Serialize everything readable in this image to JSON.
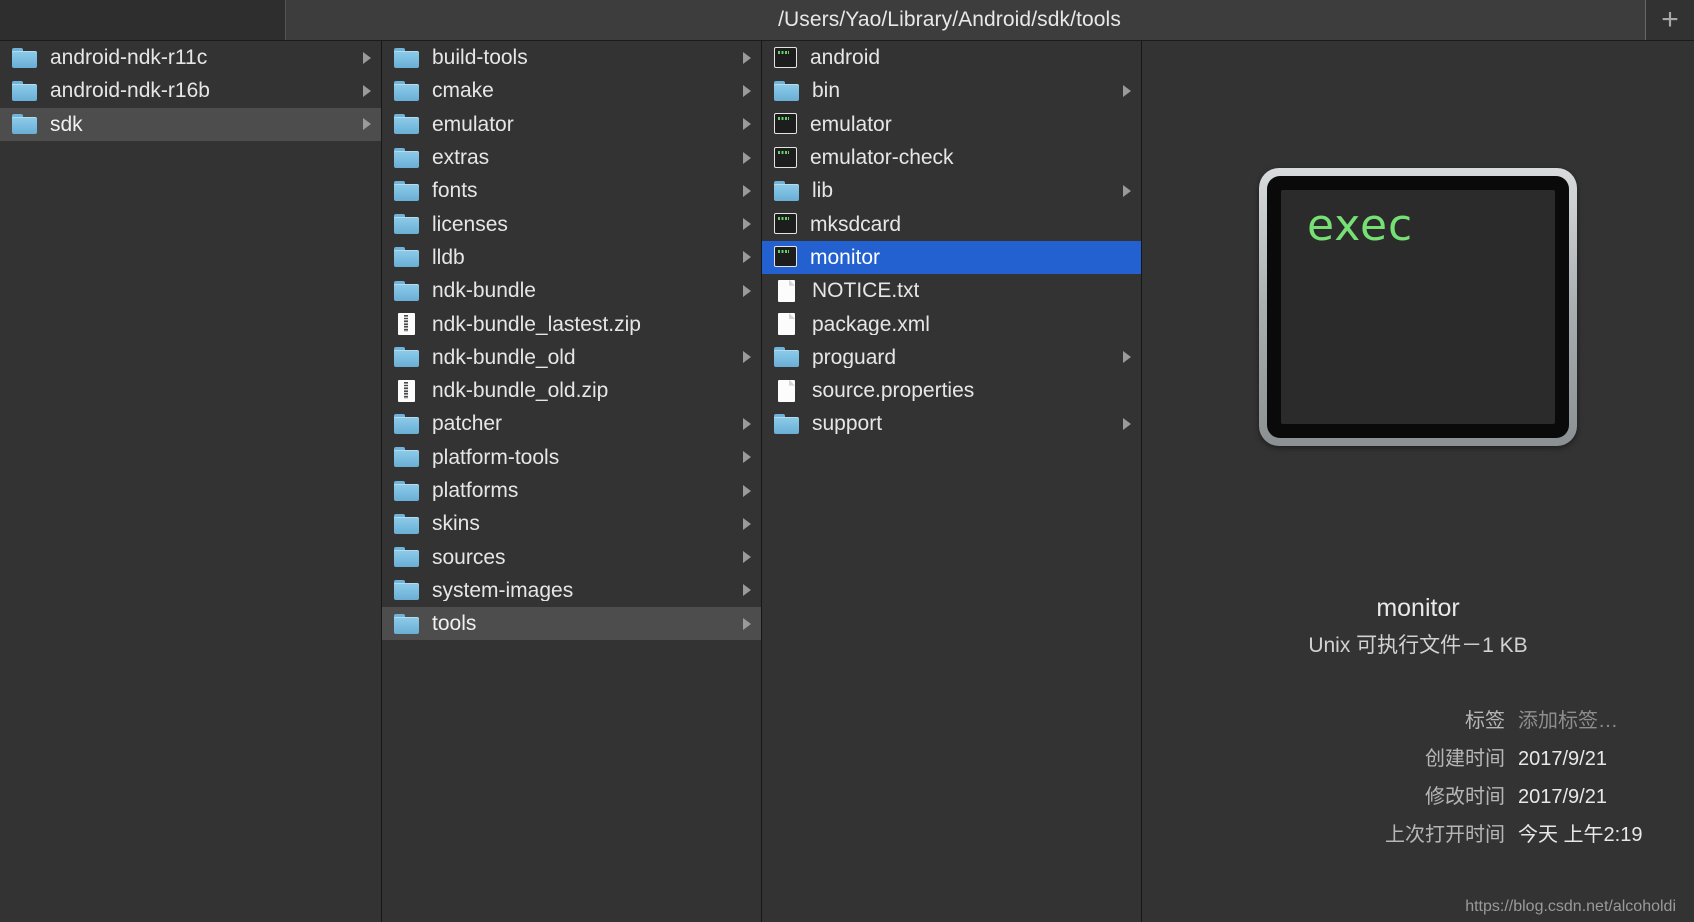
{
  "window": {
    "title": "/Users/Yao/Library/Android/sdk/tools",
    "add_button_label": "+"
  },
  "columns": [
    {
      "name": "column-1",
      "items": [
        {
          "label": "android-ndk-r11c",
          "icon": "folder-icon",
          "has_arrow": true,
          "state": "normal"
        },
        {
          "label": "android-ndk-r16b",
          "icon": "folder-icon",
          "has_arrow": true,
          "state": "normal"
        },
        {
          "label": "sdk",
          "icon": "folder-icon",
          "has_arrow": true,
          "state": "selected-inactive"
        }
      ]
    },
    {
      "name": "column-2",
      "items": [
        {
          "label": "build-tools",
          "icon": "folder-icon",
          "has_arrow": true,
          "state": "normal"
        },
        {
          "label": "cmake",
          "icon": "folder-icon",
          "has_arrow": true,
          "state": "normal"
        },
        {
          "label": "emulator",
          "icon": "folder-icon",
          "has_arrow": true,
          "state": "normal"
        },
        {
          "label": "extras",
          "icon": "folder-icon",
          "has_arrow": true,
          "state": "normal"
        },
        {
          "label": "fonts",
          "icon": "folder-icon",
          "has_arrow": true,
          "state": "normal"
        },
        {
          "label": "licenses",
          "icon": "folder-icon",
          "has_arrow": true,
          "state": "normal"
        },
        {
          "label": "lldb",
          "icon": "folder-icon",
          "has_arrow": true,
          "state": "normal"
        },
        {
          "label": "ndk-bundle",
          "icon": "folder-icon",
          "has_arrow": true,
          "state": "normal"
        },
        {
          "label": "ndk-bundle_lastest.zip",
          "icon": "zip-file-icon",
          "has_arrow": false,
          "state": "normal"
        },
        {
          "label": "ndk-bundle_old",
          "icon": "folder-icon",
          "has_arrow": true,
          "state": "normal"
        },
        {
          "label": "ndk-bundle_old.zip",
          "icon": "zip-file-icon",
          "has_arrow": false,
          "state": "normal"
        },
        {
          "label": "patcher",
          "icon": "folder-icon",
          "has_arrow": true,
          "state": "normal"
        },
        {
          "label": "platform-tools",
          "icon": "folder-icon",
          "has_arrow": true,
          "state": "normal"
        },
        {
          "label": "platforms",
          "icon": "folder-icon",
          "has_arrow": true,
          "state": "normal"
        },
        {
          "label": "skins",
          "icon": "folder-icon",
          "has_arrow": true,
          "state": "normal"
        },
        {
          "label": "sources",
          "icon": "folder-icon",
          "has_arrow": true,
          "state": "normal"
        },
        {
          "label": "system-images",
          "icon": "folder-icon",
          "has_arrow": true,
          "state": "normal"
        },
        {
          "label": "tools",
          "icon": "folder-icon",
          "has_arrow": true,
          "state": "selected-inactive"
        }
      ]
    },
    {
      "name": "column-3",
      "items": [
        {
          "label": "android",
          "icon": "unix-executable-icon",
          "has_arrow": false,
          "state": "normal"
        },
        {
          "label": "bin",
          "icon": "folder-icon",
          "has_arrow": true,
          "state": "normal"
        },
        {
          "label": "emulator",
          "icon": "unix-executable-icon",
          "has_arrow": false,
          "state": "normal"
        },
        {
          "label": "emulator-check",
          "icon": "unix-executable-icon",
          "has_arrow": false,
          "state": "normal"
        },
        {
          "label": "lib",
          "icon": "folder-icon",
          "has_arrow": true,
          "state": "normal"
        },
        {
          "label": "mksdcard",
          "icon": "unix-executable-icon",
          "has_arrow": false,
          "state": "normal"
        },
        {
          "label": "monitor",
          "icon": "unix-executable-icon",
          "has_arrow": false,
          "state": "selected-active"
        },
        {
          "label": "NOTICE.txt",
          "icon": "text-file-icon",
          "has_arrow": false,
          "state": "normal"
        },
        {
          "label": "package.xml",
          "icon": "text-file-icon",
          "has_arrow": false,
          "state": "normal"
        },
        {
          "label": "proguard",
          "icon": "folder-icon",
          "has_arrow": true,
          "state": "normal"
        },
        {
          "label": "source.properties",
          "icon": "text-file-icon",
          "has_arrow": false,
          "state": "normal"
        },
        {
          "label": "support",
          "icon": "folder-icon",
          "has_arrow": true,
          "state": "normal"
        }
      ]
    }
  ],
  "preview": {
    "icon_text": "exec",
    "icon_text_color": "#77e075",
    "name": "monitor",
    "kind": "Unix 可执行文件－1 KB",
    "metadata": [
      {
        "key": "标签",
        "value": "添加标签…",
        "placeholder": true
      },
      {
        "key": "创建时间",
        "value": "2017/9/21",
        "placeholder": false
      },
      {
        "key": "修改时间",
        "value": "2017/9/21",
        "placeholder": false
      },
      {
        "key": "上次打开时间",
        "value": "今天 上午2:19",
        "placeholder": false
      }
    ]
  },
  "watermark": "https://blog.csdn.net/alcoholdi",
  "theme": {
    "background": "#333333",
    "selection_active": "#2261cf",
    "selection_inactive": "#4d4d4d",
    "titlebar": "#3d3d3d",
    "folder_blue": "#7bbcde"
  }
}
